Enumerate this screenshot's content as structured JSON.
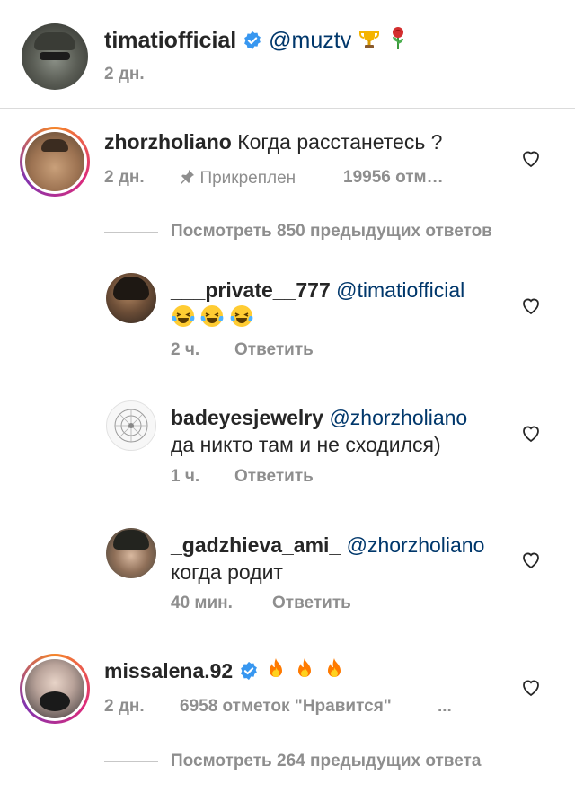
{
  "post": {
    "username": "timatiofficial",
    "mention": "@muztv",
    "emoji": [
      "trophy-icon",
      "rose-icon"
    ],
    "time": "2 дн."
  },
  "comments": [
    {
      "username": "zhorzholiano",
      "text": "Когда расстанетесь ?",
      "time": "2 дн.",
      "pinned_label": "Прикреплен",
      "likes": "19956 отм…",
      "view_replies": "Посмотреть 850 предыдущих ответов",
      "replies": [
        {
          "username": "___private__777",
          "mention": "@timatiofficial",
          "emoji": [
            "laughing-crying-icon",
            "laughing-crying-icon",
            "laughing-crying-icon"
          ],
          "time": "2 ч.",
          "reply_label": "Ответить"
        },
        {
          "username": "badeyesjewelry",
          "mention": "@zhorzholiano",
          "text": "да никто там и не сходился)",
          "time": "1 ч.",
          "reply_label": "Ответить"
        },
        {
          "username": "_gadzhieva_ami_",
          "mention": "@zhorzholiano",
          "text": "когда родит",
          "time": "40 мин.",
          "reply_label": "Ответить"
        }
      ]
    },
    {
      "username": "missalena.92",
      "emoji": [
        "fire-icon",
        "fire-icon",
        "fire-icon"
      ],
      "time": "2 дн.",
      "likes": "6958 отметок \"Нравится\"",
      "more": "...",
      "view_replies": "Посмотреть 264 предыдущих ответа"
    }
  ],
  "colors": {
    "mention": "#00376b",
    "meta": "#8e8e8e",
    "verified": "#3897f0"
  }
}
